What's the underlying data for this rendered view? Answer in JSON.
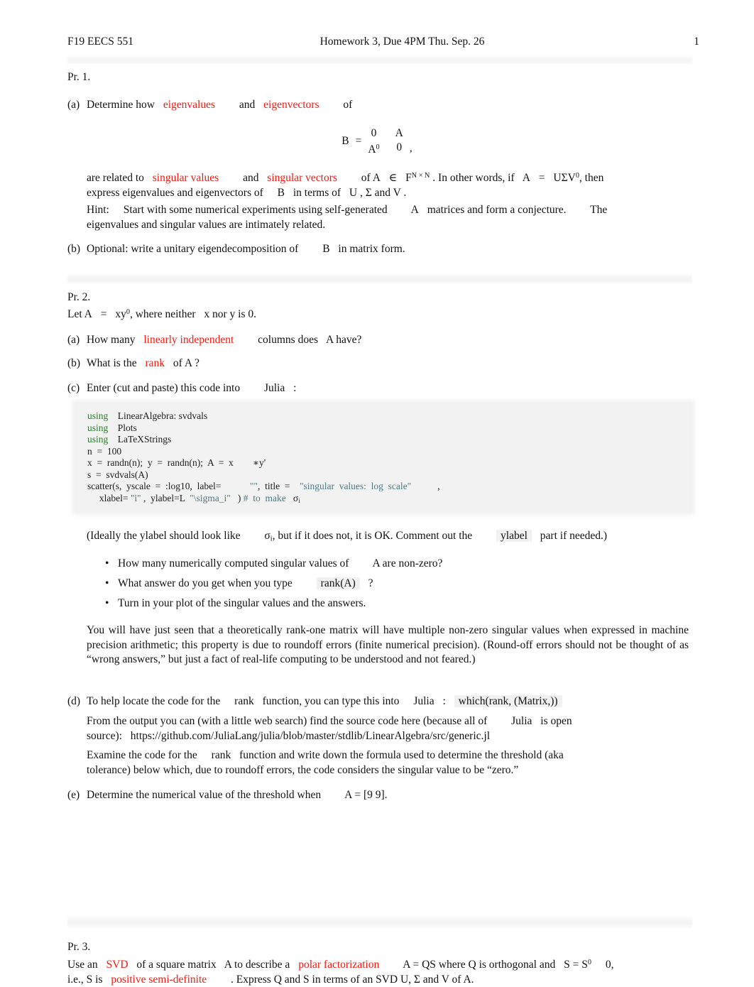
{
  "header": {
    "left": "F19 EECS 551",
    "center": "Homework 3, Due 4PM Thu. Sep. 26",
    "page_number": "1"
  },
  "pr1": {
    "title": "Pr. 1.",
    "a_label": "(a)",
    "a_text_1": "Determine how",
    "a_kw_eigenvalues": "eigenvalues",
    "a_and": "and",
    "a_kw_eigenvectors": "eigenvectors",
    "a_of": "of",
    "matrix": {
      "lhs": "B",
      "eq": "=",
      "cells": [
        "0",
        "A",
        "A",
        "0"
      ],
      "prime_marker": "0",
      "trailing_comma": ","
    },
    "cont_line1_a": "are related to",
    "cont_kw_singular_values": "singular values",
    "cont_and": "and",
    "cont_kw_singular_vectors": "singular vectors",
    "cont_line1_b": "of A",
    "cont_in": "∈",
    "cont_field": "F",
    "cont_field_exp": "N × N",
    "cont_line1_c": ". In other words, if",
    "cont_svd_a": "A",
    "cont_svd_eq": "=",
    "cont_svd_usv": "UΣV",
    "cont_svd_prime": "0",
    "cont_line1_d": ", then",
    "cont_line2": "express eigenvalues and eigenvectors of",
    "cont_line2_b": "B",
    "cont_line2_c": "in terms of",
    "cont_line2_d": "U , Σ  and  V .",
    "hint_label": "Hint:",
    "hint_1": "Start with some numerical experiments using self-generated",
    "hint_A": "A",
    "hint_2": "matrices and form a conjecture.",
    "hint_3": "The",
    "hint_4": "eigenvalues and singular values are intimately related.",
    "b_label": "(b)",
    "b_text_1": "Optional: write a unitary eigendecomposition of",
    "b_B": "B",
    "b_text_2": "in matrix form."
  },
  "pr2": {
    "title": "Pr. 2.",
    "let_1": "Let A",
    "let_eq": "=",
    "let_xy": "xy",
    "let_prime": "0",
    "let_2": ", where neither",
    "let_3": "x nor y is 0.",
    "a_label": "(a)",
    "a_text_1": "How many",
    "a_kw": "linearly independent",
    "a_text_2": "columns does",
    "a_text_3": "A have?",
    "b_label": "(b)",
    "b_text_1": "What is the",
    "b_kw": "rank",
    "b_text_2": "of A ?",
    "c_label": "(c)",
    "c_text_1": "Enter (cut and paste) this code into",
    "c_julia": "Julia",
    "c_text_2": ":",
    "code": {
      "l1_kw": "using",
      "l1_rest": "LinearAlgebra: svdvals",
      "l2_kw": "using",
      "l2_rest": "Plots",
      "l3_kw": "using",
      "l3_rest": "LaTeXStrings",
      "l4": "n  =  100",
      "l5": "x  =  randn(n);  y  =  randn(n);  A  =  x",
      "l5_tail": "∗y'",
      "l6": "s  =  svdvals(A)",
      "l7_a": "scatter(s,  yscale  =  :log10,  label=",
      "l7_empty_str": "\"\"",
      "l7_b": ",  title  =",
      "l7_title_str": "\"singular  values:  log  scale\"",
      "l7_c": ",",
      "l8_a": "xlabel=",
      "l8_i_str": "\"i\"",
      "l8_b": ",  ylabel=L",
      "l8_sigma_str": "\"\\sigma_i\"",
      "l8_c": ")",
      "l8_comment": "#  to  make",
      "l8_sigma": "σ",
      "l8_sigma_sub": "i"
    },
    "ideal_1": "(Ideally the ylabel should look like",
    "ideal_sigma": "σ",
    "ideal_sigma_sub": "i",
    "ideal_2": ", but if it does not, it is OK. Comment out the",
    "ideal_code": "ylabel",
    "ideal_3": "part if needed.)",
    "bullets": [
      {
        "text_a": "How many numerically computed singular values of",
        "text_b": "A  are non-zero?"
      },
      {
        "text_a": "What answer do you get when you type",
        "code": "rank(A)",
        "text_b": "?"
      },
      {
        "text_a": "Turn in your plot of the singular values and the answers.",
        "text_b": ""
      }
    ],
    "para": "You will have just seen that a theoretically rank-one matrix will have multiple non-zero singular values when expressed in machine precision arithmetic; this property is due to roundoff errors (finite numerical precision). (Round-off errors should not be thought of as “wrong answers,” but just a fact of real-life computing to be understood and not feared.)",
    "d_label": "(d)",
    "d_text_1": "To help locate the code for the",
    "d_rank": "rank",
    "d_text_2": "function, you can type this into",
    "d_julia": "Julia",
    "d_colon": ":",
    "d_code": "which(rank, (Matrix,))",
    "d_text_3": "From the output you can (with a little web search) find the source code here (because all of",
    "d_julia_2": "Julia",
    "d_text_4": "is open",
    "d_text_5": "source):",
    "d_url": "https://github.com/JuliaLang/julia/blob/master/stdlib/LinearAlgebra/src/generic.jl",
    "d_text_6": "Examine the code for the",
    "d_rank_2": "rank",
    "d_text_7": "function and write down the formula used to determine the threshold (aka",
    "d_text_8": "tolerance) below which, due to roundoff errors, the code considers the singular value to be “zero.”",
    "e_label": "(e)",
    "e_text_1": "Determine the numerical value of the threshold when",
    "e_text_2": "A = [9 9]."
  },
  "pr3": {
    "title": "Pr. 3.",
    "line1_a": "Use an",
    "line1_svd": "SVD",
    "line1_b": "of a square matrix",
    "line1_c": "A to describe a",
    "line1_polar": "polar factorization",
    "line1_d": "A  =  QS  where Q is orthogonal and",
    "line1_e": "S  =  S",
    "line1_prime": "0",
    "line1_f": "0,",
    "line2_a": "i.e., S is",
    "line2_psd": "positive semi-definite",
    "line2_b": ". Express Q and S in terms of an SVD U, Σ and V of A."
  }
}
